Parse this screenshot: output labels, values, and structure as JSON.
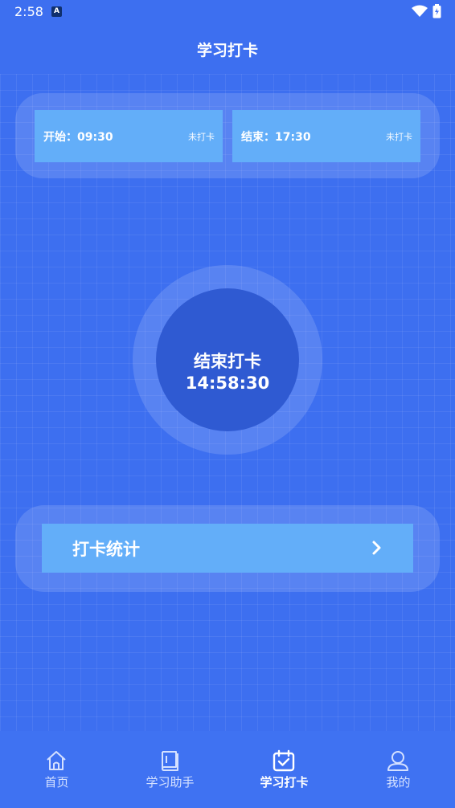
{
  "status_bar": {
    "time": "2:58",
    "notification_icon": "a-icon",
    "wifi_icon": "wifi-icon",
    "battery_icon": "battery-icon"
  },
  "header": {
    "title": "学习打卡"
  },
  "punch_cards": [
    {
      "label": "开始：09:30",
      "status": "未打卡"
    },
    {
      "label": "结束：17:30",
      "status": "未打卡"
    }
  ],
  "clock_button": {
    "label": "结束打卡",
    "time": "14:58:30"
  },
  "stats": {
    "label": "打卡统计",
    "icon": "chevron-right-icon"
  },
  "tab_bar": {
    "items": [
      {
        "label": "首页",
        "icon": "home-icon",
        "active": false
      },
      {
        "label": "学习助手",
        "icon": "book-icon",
        "active": false
      },
      {
        "label": "学习打卡",
        "icon": "calendar-check-icon",
        "active": true
      },
      {
        "label": "我的",
        "icon": "person-icon",
        "active": false
      }
    ]
  },
  "colors": {
    "background": "#3d6ff0",
    "card": "#63aef9",
    "circle_inner": "#2f5ad2",
    "tab_bar": "#3f72f2"
  }
}
